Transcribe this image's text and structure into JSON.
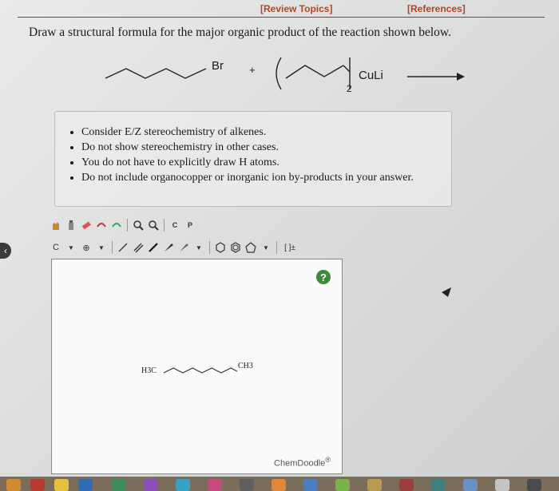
{
  "header": {
    "review_topics": "[Review Topics]",
    "references": "[References]"
  },
  "question": "Draw a structural formula for the major organic product of the reaction shown below.",
  "reaction": {
    "leaving_group": "Br",
    "plus": "+",
    "reagent_subscript": "2",
    "reagent_metal": "CuLi"
  },
  "instructions": [
    "Consider E/Z stereochemistry of alkenes.",
    "Do not show stereochemistry in other cases.",
    "You do not have to explicitly draw H atoms.",
    "Do not include organocopper or inorganic ion by-products in your answer."
  ],
  "editor": {
    "toolbar1_icons": [
      "hand-icon",
      "bottle-icon",
      "eraser-icon",
      "undo-icon",
      "redo-icon",
      "zoom-in-icon",
      "zoom-out-icon",
      "copy-icon",
      "paste-icon"
    ],
    "copy_label": "C",
    "paste_label": "P",
    "atom_label": "C",
    "charge_label": "⊕",
    "brackets_label": "[ ]±",
    "help_label": "?",
    "brand": "ChemDoodle",
    "brand_mark": "®",
    "drawn_molecule": {
      "left_label": "H3C",
      "right_label": "CH3"
    }
  },
  "colors": {
    "header_link": "#b8431f",
    "help_green": "#3e8a3b"
  }
}
